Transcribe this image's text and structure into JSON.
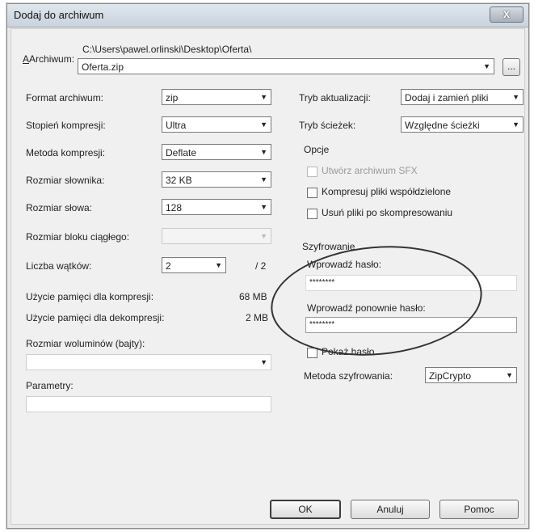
{
  "window": {
    "title": "Dodaj do archiwum",
    "close_label": "X"
  },
  "archive": {
    "label": "Archiwum:",
    "path": "C:\\Users\\pawel.orlinski\\Desktop\\Oferta\\",
    "filename": "Oferta.zip",
    "browse_label": "..."
  },
  "left": {
    "format": {
      "label": "Format archiwum:",
      "value": "zip"
    },
    "compression_level": {
      "label": "Stopień kompresji:",
      "value": "Ultra"
    },
    "compression_method": {
      "label": "Metoda kompresji:",
      "value": "Deflate"
    },
    "dictionary_size": {
      "label": "Rozmiar słownika:",
      "value": "32 KB"
    },
    "word_size": {
      "label": "Rozmiar słowa:",
      "value": "128"
    },
    "solid_block": {
      "label": "Rozmiar bloku ciągłego:",
      "value": ""
    },
    "threads": {
      "label": "Liczba wątków:",
      "value": "2",
      "max": "/ 2"
    },
    "memory_compress": {
      "label": "Użycie pamięci dla kompresji:",
      "value": "68 MB"
    },
    "memory_decompress": {
      "label": "Użycie pamięci dla dekompresji:",
      "value": "2 MB"
    },
    "volume_size": {
      "label": "Rozmiar woluminów (bajty):",
      "value": ""
    },
    "parameters": {
      "label": "Parametry:",
      "value": ""
    }
  },
  "right": {
    "update_mode": {
      "label": "Tryb aktualizacji:",
      "value": "Dodaj i zamień pliki"
    },
    "path_mode": {
      "label": "Tryb ścieżek:",
      "value": "Względne ścieżki"
    },
    "options": {
      "label": "Opcje",
      "sfx": "Utwórz archiwum SFX",
      "shared": "Kompresuj pliki współdzielone",
      "delete_after": "Usuń pliki po skompresowaniu"
    },
    "encryption": {
      "label": "Szyfrowanie",
      "password_label": "Wprowadź hasło:",
      "password_value": "********",
      "repeat_label": "Wprowadź ponownie hasło:",
      "repeat_value": "********",
      "show_password": "Pokaż hasło",
      "method_label": "Metoda szyfrowania:",
      "method_value": "ZipCrypto"
    }
  },
  "buttons": {
    "ok": "OK",
    "cancel": "Anuluj",
    "help": "Pomoc"
  }
}
